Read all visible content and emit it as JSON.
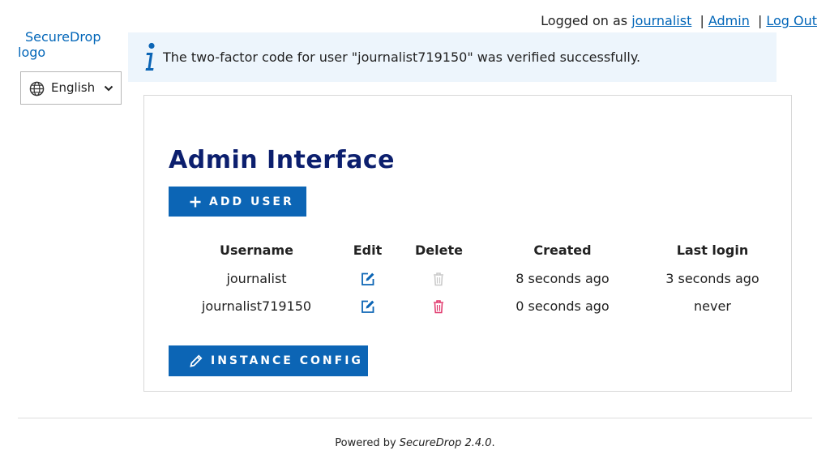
{
  "header": {
    "logged_on_prefix": "Logged on as",
    "username_link": "journalist",
    "admin_link": "Admin",
    "logout_link": "Log Out",
    "separator": "|"
  },
  "sidebar": {
    "logo_line1": "SecureDrop",
    "logo_line2": "logo",
    "language": "English"
  },
  "flash": {
    "message": "The two-factor code for user \"journalist719150\" was verified successfully."
  },
  "main": {
    "title": "Admin Interface",
    "add_user_label": "Add User",
    "instance_config_label": "Instance Config",
    "table": {
      "headers": {
        "username": "Username",
        "edit": "Edit",
        "delete": "Delete",
        "created": "Created",
        "last_login": "Last login"
      },
      "rows": [
        {
          "username": "journalist",
          "created": "8 seconds ago",
          "last_login": "3 seconds ago",
          "delete_enabled": false
        },
        {
          "username": "journalist719150",
          "created": "0 seconds ago",
          "last_login": "never",
          "delete_enabled": true
        }
      ]
    }
  },
  "footer": {
    "powered_by": "Powered by",
    "product": "SecureDrop 2.4.0",
    "trailing": "."
  },
  "colors": {
    "link": "#0065b8",
    "button_bg": "#0c65b5",
    "title": "#0c1f6e",
    "delete_active": "#e0356a",
    "delete_disabled": "#c8c8c8",
    "flash_bg": "#edf5fc"
  }
}
